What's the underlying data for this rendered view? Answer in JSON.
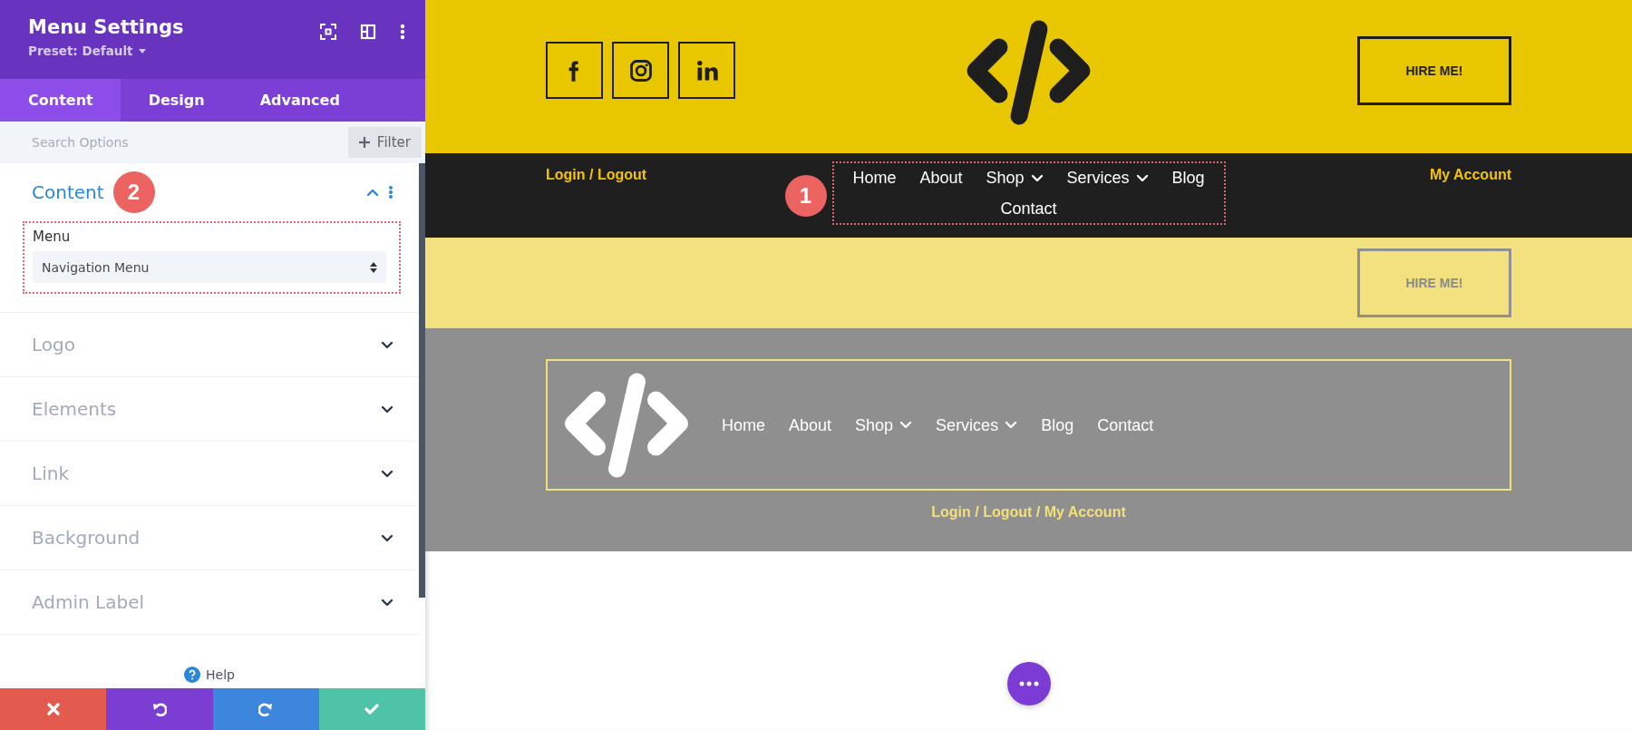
{
  "panel": {
    "title": "Menu Settings",
    "preset": "Preset: Default",
    "tabs": [
      {
        "label": "Content",
        "selected": true
      },
      {
        "label": "Design",
        "selected": false
      },
      {
        "label": "Advanced",
        "selected": false
      }
    ],
    "search": {
      "placeholder": "Search Options"
    },
    "filter_button": "Filter",
    "sections": [
      {
        "title": "Content",
        "expanded": true,
        "badge": "2",
        "field": {
          "label": "Menu",
          "value": "Navigation Menu"
        }
      },
      {
        "title": "Logo",
        "expanded": false
      },
      {
        "title": "Elements",
        "expanded": false
      },
      {
        "title": "Link",
        "expanded": false
      },
      {
        "title": "Background",
        "expanded": false
      },
      {
        "title": "Admin Label",
        "expanded": false
      }
    ],
    "help": "Help",
    "actions": [
      {
        "kind": "cancel"
      },
      {
        "kind": "undo"
      },
      {
        "kind": "redo"
      },
      {
        "kind": "save"
      }
    ]
  },
  "preview": {
    "header": {
      "social": [
        {
          "kind": "facebook"
        },
        {
          "kind": "instagram"
        },
        {
          "kind": "linkedin"
        }
      ],
      "button": "HIRE ME!"
    },
    "nav_bar": {
      "left_link": "Login / Logout",
      "badge": "1",
      "menu": [
        {
          "label": "Home",
          "has_submenu": false
        },
        {
          "label": "About",
          "has_submenu": false
        },
        {
          "label": "Shop",
          "has_submenu": true
        },
        {
          "label": "Services",
          "has_submenu": true
        },
        {
          "label": "Blog",
          "has_submenu": false
        },
        {
          "label": "Contact",
          "has_submenu": false
        }
      ],
      "right_link": "My Account"
    },
    "sticky_bar": {
      "button": "HIRE ME!"
    },
    "footer": {
      "menu": [
        {
          "label": "Home",
          "has_submenu": false
        },
        {
          "label": "About",
          "has_submenu": false
        },
        {
          "label": "Shop",
          "has_submenu": true
        },
        {
          "label": "Services",
          "has_submenu": true
        },
        {
          "label": "Blog",
          "has_submenu": false
        },
        {
          "label": "Contact",
          "has_submenu": false
        }
      ],
      "links": "Login / Logout / My Account"
    }
  }
}
